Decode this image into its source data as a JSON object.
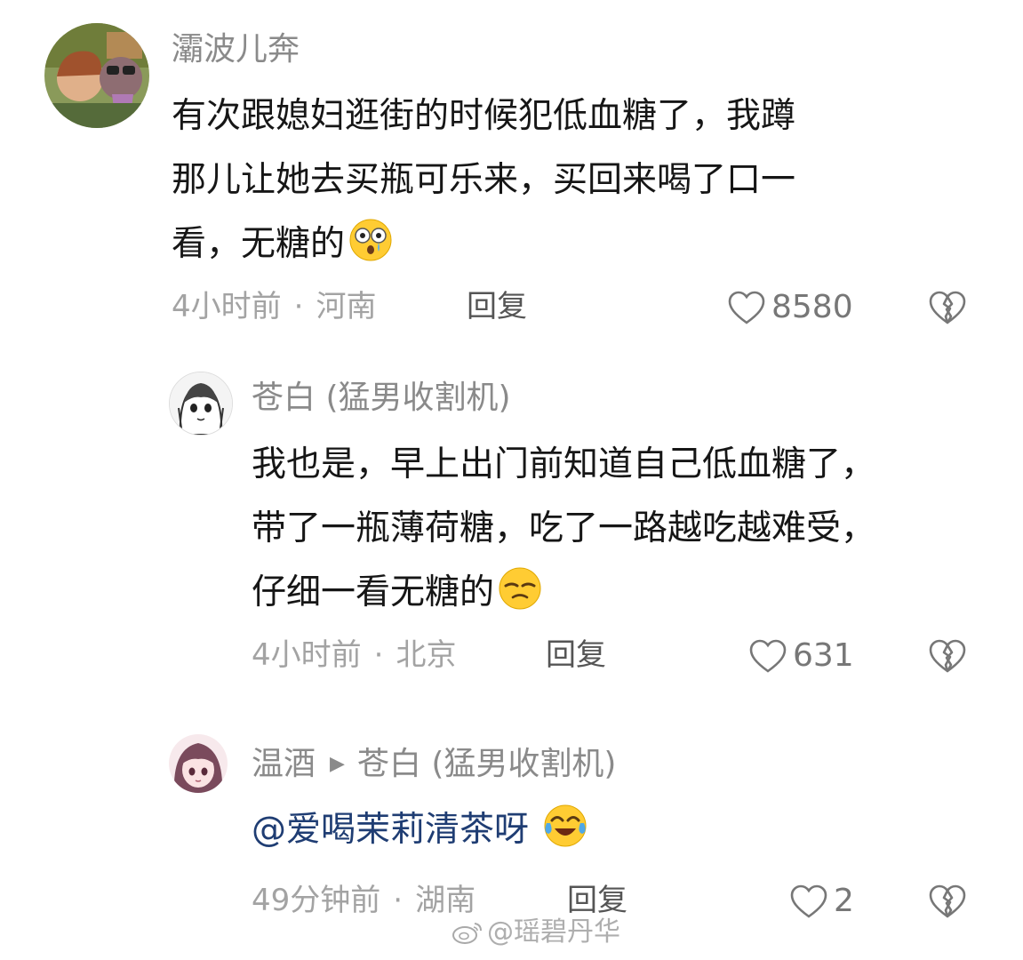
{
  "comments": [
    {
      "username": "灞波儿奔",
      "avatar": "cartoon-avatar",
      "lines": [
        "有次跟媳妇逛街的时候犯低血糖了，我蹲",
        "那儿让她去买瓶可乐来，买回来喝了口一",
        "看，无糖的"
      ],
      "emoji": "shocked-crying-emoji",
      "time": "4小时前",
      "location": "河南",
      "reply_label": "回复",
      "likes": "8580"
    },
    {
      "username": "苍白 (猛男收割机)",
      "avatar": "anime-girl-avatar",
      "lines": [
        "我也是，早上出门前知道自己低血糖了，",
        "带了一瓶薄荷糖，吃了一路越吃越难受，",
        "仔细一看无糖的"
      ],
      "emoji": "smirk-emoji",
      "time": "4小时前",
      "location": "北京",
      "reply_label": "回复",
      "likes": "631"
    },
    {
      "username": "温酒",
      "reply_to": "苍白 (猛男收割机)",
      "avatar": "anime-girl-pink-avatar",
      "mention": "@爱喝茉莉清茶呀",
      "emoji": "laugh-cry-emoji",
      "time": "49分钟前",
      "location": "湖南",
      "reply_label": "回复",
      "likes": "2"
    }
  ],
  "separator": "·",
  "watermark": "@瑶碧丹华",
  "colors": {
    "username": "#8a8a8a",
    "text": "#161616",
    "meta": "#a3a3a3",
    "mention": "#1f3d73"
  }
}
